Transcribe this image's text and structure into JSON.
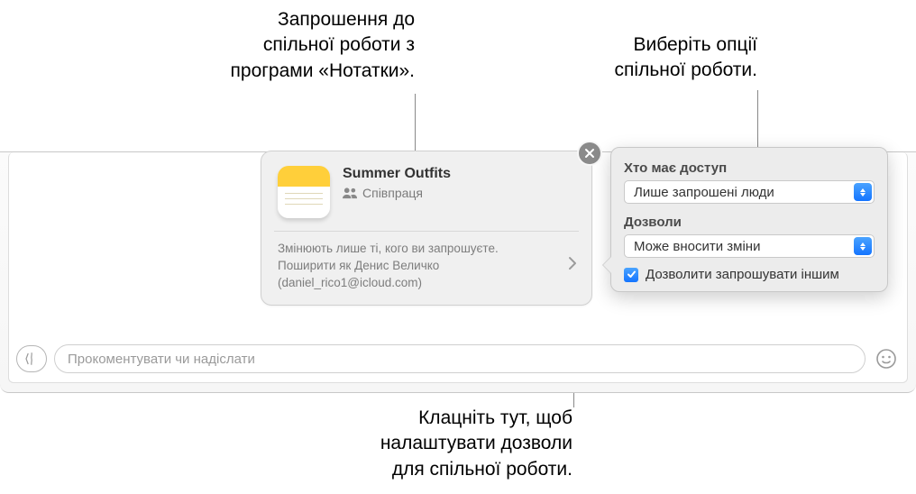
{
  "callouts": {
    "top_left": "Запрошення до\nспільної роботи з\nпрограми «Нотатки».",
    "top_right": "Виберіть опції\nспільної роботи.",
    "bottom": "Клацніть тут, щоб\nналаштувати дозволи\nдля спільної роботи."
  },
  "invite": {
    "title": "Summer Outfits",
    "collab_label": "Співпраця",
    "perm_line": "Змінюють лише ті, кого ви запрошуєте.",
    "share_as_line": "Поширити як Денис Величко",
    "email_line": "(daniel_rico1@icloud.com)"
  },
  "popover": {
    "access_label": "Хто має доступ",
    "access_value": "Лише запрошені люди",
    "perm_label": "Дозволи",
    "perm_value": "Може вносити зміни",
    "allow_invite": "Дозволити запрошувати іншим"
  },
  "compose": {
    "placeholder": "Прокоментувати чи надіслати"
  }
}
